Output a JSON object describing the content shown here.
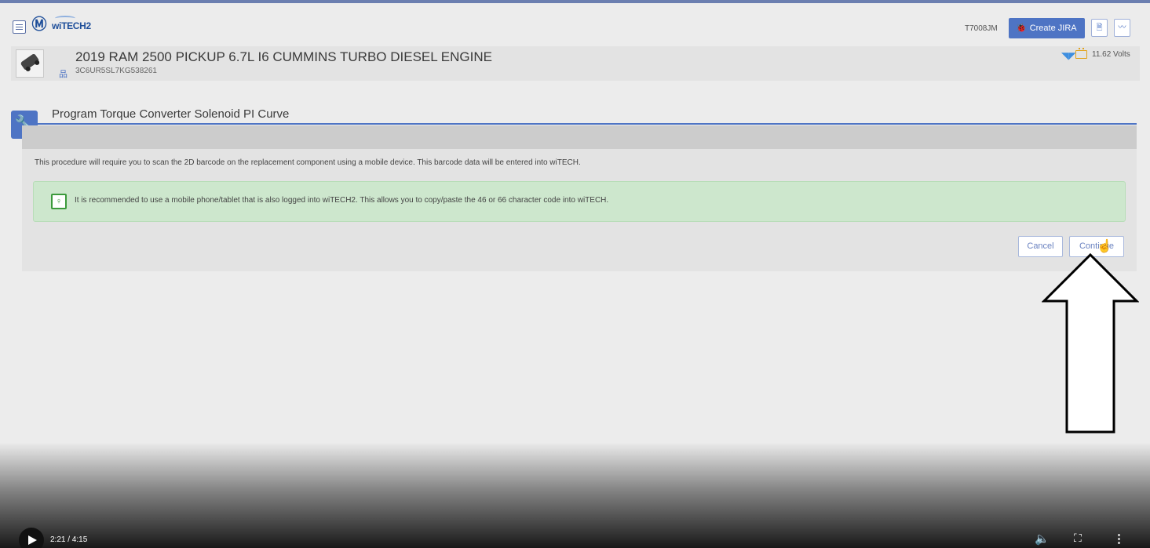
{
  "header": {
    "logo_text": "wiTECH2",
    "user_id": "T7008JM",
    "create_jira_label": "Create JIRA",
    "icons": [
      "menu-icon",
      "mopar-logo",
      "witech-logo",
      "pdf-icon",
      "rss-icon"
    ]
  },
  "vehicle": {
    "title": "2019 RAM 2500 PICKUP 6.7L I6 CUMMINS TURBO DIESEL ENGINE",
    "vin": "3C6UR5SL7KG538261",
    "volts": "11.62 Volts"
  },
  "procedure": {
    "title": "Program Torque Converter Solenoid PI Curve",
    "description": "This procedure will require you to scan the 2D barcode on the replacement component using a mobile device. This barcode data will be entered into wiTECH.",
    "tip": "It is recommended to use a mobile phone/tablet that is also logged into wiTECH2. This allows you to copy/paste the 46 or 66 character code into wiTECH.",
    "cancel_label": "Cancel",
    "continue_label": "Continue"
  },
  "video": {
    "time": "2:21 / 4:15"
  },
  "colors": {
    "accent": "#4e74c4",
    "tip_bg": "#cde7cd",
    "tip_icon": "#3c9a3c",
    "battery": "#e2a21b"
  }
}
